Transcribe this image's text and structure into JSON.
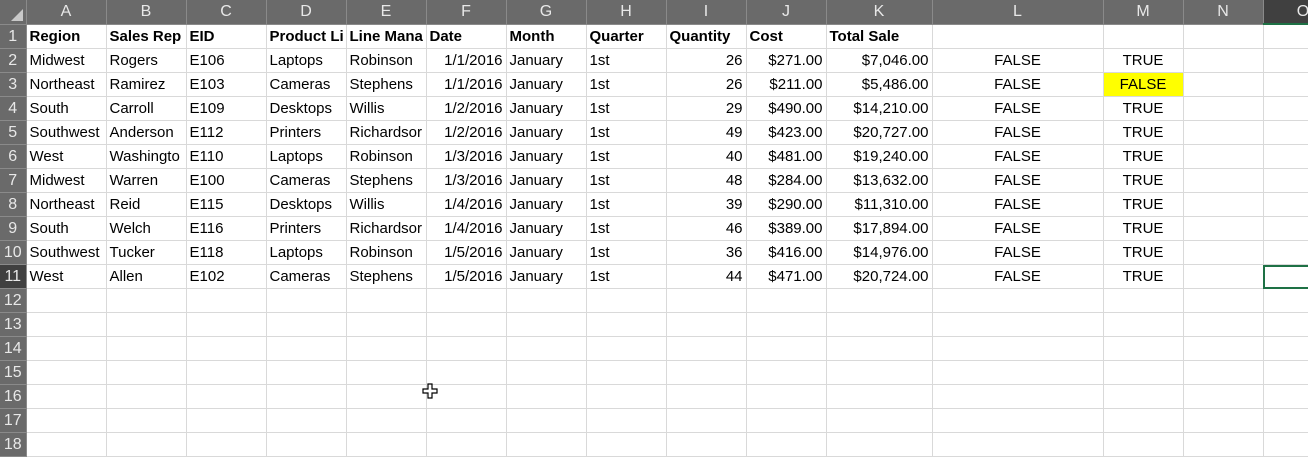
{
  "columns": [
    "A",
    "B",
    "C",
    "D",
    "E",
    "F",
    "G",
    "H",
    "I",
    "J",
    "K",
    "L",
    "M",
    "N",
    "O"
  ],
  "row_numbers": [
    "1",
    "2",
    "3",
    "4",
    "5",
    "6",
    "7",
    "8",
    "9",
    "10",
    "11",
    "12",
    "13",
    "14",
    "15",
    "16",
    "17",
    "18"
  ],
  "header_row": {
    "a": "Region",
    "b": "Sales Rep",
    "c": "EID",
    "d": "Product Li",
    "e": "Line Mana",
    "f": "Date",
    "g": "Month",
    "h": "Quarter",
    "i": "Quantity",
    "j": "Cost",
    "k": "Total Sale",
    "l": "",
    "m": "",
    "n": "",
    "o": ""
  },
  "rows": [
    {
      "a": "Midwest",
      "b": "Rogers",
      "c": "E106",
      "d": "Laptops",
      "e": "Robinson",
      "f": "1/1/2016",
      "g": "January",
      "h": "1st",
      "i": "26",
      "j": "$271.00",
      "k": "$7,046.00",
      "l": "FALSE",
      "m": "TRUE"
    },
    {
      "a": "Northeast",
      "b": "Ramirez",
      "c": "E103",
      "d": "Cameras",
      "e": "Stephens",
      "f": "1/1/2016",
      "g": "January",
      "h": "1st",
      "i": "26",
      "j": "$211.00",
      "k": "$5,486.00",
      "l": "FALSE",
      "m": "FALSE"
    },
    {
      "a": "South",
      "b": "Carroll",
      "c": "E109",
      "d": "Desktops",
      "e": "Willis",
      "f": "1/2/2016",
      "g": "January",
      "h": "1st",
      "i": "29",
      "j": "$490.00",
      "k": "$14,210.00",
      "l": "FALSE",
      "m": "TRUE"
    },
    {
      "a": "Southwest",
      "b": "Anderson",
      "c": "E112",
      "d": "Printers",
      "e": "Richardsor",
      "f": "1/2/2016",
      "g": "January",
      "h": "1st",
      "i": "49",
      "j": "$423.00",
      "k": "$20,727.00",
      "l": "FALSE",
      "m": "TRUE"
    },
    {
      "a": "West",
      "b": "Washingto",
      "c": "E110",
      "d": "Laptops",
      "e": "Robinson",
      "f": "1/3/2016",
      "g": "January",
      "h": "1st",
      "i": "40",
      "j": "$481.00",
      "k": "$19,240.00",
      "l": "FALSE",
      "m": "TRUE"
    },
    {
      "a": "Midwest",
      "b": "Warren",
      "c": "E100",
      "d": "Cameras",
      "e": "Stephens",
      "f": "1/3/2016",
      "g": "January",
      "h": "1st",
      "i": "48",
      "j": "$284.00",
      "k": "$13,632.00",
      "l": "FALSE",
      "m": "TRUE"
    },
    {
      "a": "Northeast",
      "b": "Reid",
      "c": "E115",
      "d": "Desktops",
      "e": "Willis",
      "f": "1/4/2016",
      "g": "January",
      "h": "1st",
      "i": "39",
      "j": "$290.00",
      "k": "$11,310.00",
      "l": "FALSE",
      "m": "TRUE"
    },
    {
      "a": "South",
      "b": "Welch",
      "c": "E116",
      "d": "Printers",
      "e": "Richardsor",
      "f": "1/4/2016",
      "g": "January",
      "h": "1st",
      "i": "46",
      "j": "$389.00",
      "k": "$17,894.00",
      "l": "FALSE",
      "m": "TRUE"
    },
    {
      "a": "Southwest",
      "b": "Tucker",
      "c": "E118",
      "d": "Laptops",
      "e": "Robinson",
      "f": "1/5/2016",
      "g": "January",
      "h": "1st",
      "i": "36",
      "j": "$416.00",
      "k": "$14,976.00",
      "l": "FALSE",
      "m": "TRUE"
    },
    {
      "a": "West",
      "b": "Allen",
      "c": "E102",
      "d": "Cameras",
      "e": "Stephens",
      "f": "1/5/2016",
      "g": "January",
      "h": "1st",
      "i": "44",
      "j": "$471.00",
      "k": "$20,724.00",
      "l": "FALSE",
      "m": "TRUE"
    }
  ],
  "active_cell": "O11",
  "highlight_cell": "M3",
  "colors": {
    "header_bg": "#6a6a6a",
    "active_header_bg": "#404040",
    "active_border": "#1e7145",
    "highlight": "#ffff00",
    "gridline": "#d9d9d9"
  },
  "cursor_icon": "move-cross-cursor"
}
